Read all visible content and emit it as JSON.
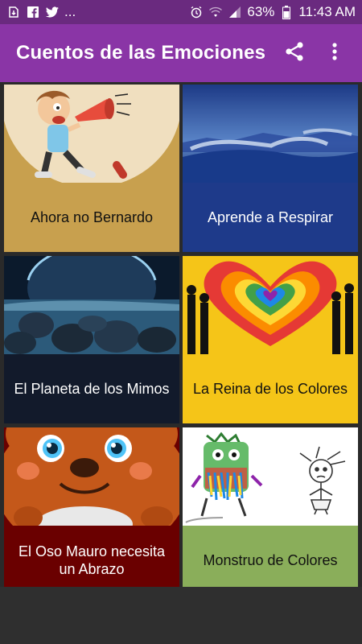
{
  "status": {
    "battery": "63%",
    "time": "11:43 AM",
    "more": "..."
  },
  "appbar": {
    "title": "Cuentos de las Emociones"
  },
  "stories": [
    {
      "title": "Ahora no Bernardo",
      "bg": "#c8a04e",
      "fg": "#111111"
    },
    {
      "title": "Aprende a Respirar",
      "bg": "#1e3a8a",
      "fg": "#ffffff"
    },
    {
      "title": "El Planeta de los Mimos",
      "bg": "#121a2b",
      "fg": "#ffffff"
    },
    {
      "title": "La Reina de los Colores",
      "bg": "#f5c518",
      "fg": "#111111"
    },
    {
      "title": "El Oso Mauro necesita un Abrazo",
      "bg": "#6a0000",
      "fg": "#ffffff"
    },
    {
      "title": "Monstruo de Colores",
      "bg": "#8aae5a",
      "fg": "#111111"
    }
  ],
  "colors": {
    "status_bar": "#6a2a7f",
    "app_bar": "#8a35a6",
    "background": "#2a2a2a"
  }
}
